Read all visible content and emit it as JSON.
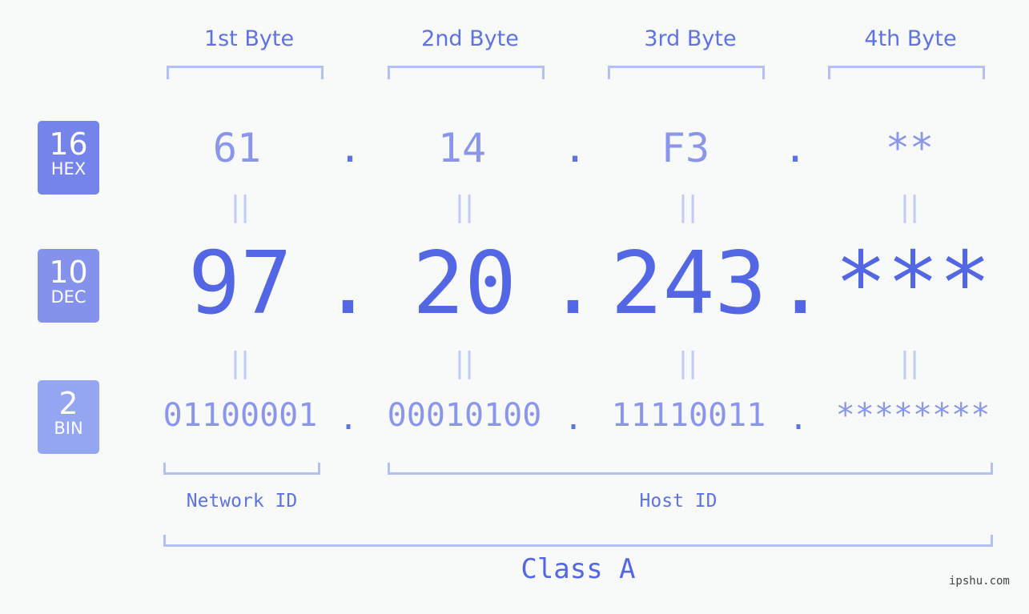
{
  "headers": [
    "1st Byte",
    "2nd Byte",
    "3rd Byte",
    "4th Byte"
  ],
  "badges": {
    "hex": {
      "number": "16",
      "label": "HEX",
      "color": "#7584ea"
    },
    "dec": {
      "number": "10",
      "label": "DEC",
      "color": "#8492ec"
    },
    "bin": {
      "number": "2",
      "label": "BIN",
      "color": "#94a6f2"
    }
  },
  "hex": [
    "61",
    "14",
    "F3",
    "**"
  ],
  "dec": [
    "97",
    "20",
    "243",
    "***"
  ],
  "bin": [
    "01100001",
    "00010100",
    "11110011",
    "********"
  ],
  "separator": ".",
  "equals": "||",
  "labels": {
    "network": "Network ID",
    "host": "Host ID",
    "class": "Class A"
  },
  "credit": "ipshu.com"
}
